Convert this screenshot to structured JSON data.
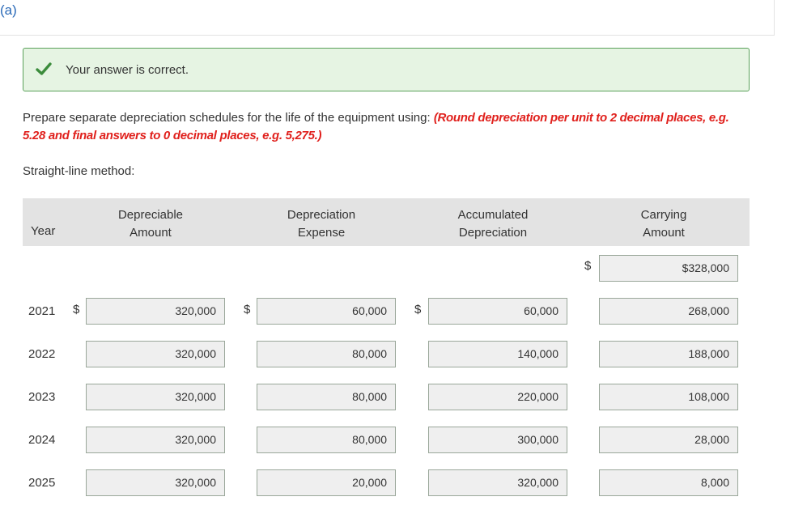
{
  "part": {
    "label": "(a)"
  },
  "feedback": {
    "message": "Your answer is correct."
  },
  "instructions": {
    "text": "Prepare separate depreciation schedules for the life of the equipment using: ",
    "note": "(Round depreciation per unit to 2 decimal places, e.g. 5.28 and final answers to 0 decimal places, e.g. 5,275.)"
  },
  "method": {
    "label": "Straight-line method:"
  },
  "table": {
    "headers": {
      "year": "Year",
      "depreciable_amount": [
        "Depreciable",
        "Amount"
      ],
      "depreciation_expense": [
        "Depreciation",
        "Expense"
      ],
      "accumulated_depreciation": [
        "Accumulated",
        "Depreciation"
      ],
      "carrying_amount": [
        "Carrying",
        "Amount"
      ]
    },
    "currency_symbol": "$",
    "initial_carrying_amount": "$328,000",
    "rows": [
      {
        "year": "2021",
        "depreciable_amount": "320,000",
        "depreciation_expense": "60,000",
        "accumulated_depreciation": "60,000",
        "carrying_amount": "268,000"
      },
      {
        "year": "2022",
        "depreciable_amount": "320,000",
        "depreciation_expense": "80,000",
        "accumulated_depreciation": "140,000",
        "carrying_amount": "188,000"
      },
      {
        "year": "2023",
        "depreciable_amount": "320,000",
        "depreciation_expense": "80,000",
        "accumulated_depreciation": "220,000",
        "carrying_amount": "108,000"
      },
      {
        "year": "2024",
        "depreciable_amount": "320,000",
        "depreciation_expense": "80,000",
        "accumulated_depreciation": "300,000",
        "carrying_amount": "28,000"
      },
      {
        "year": "2025",
        "depreciable_amount": "320,000",
        "depreciation_expense": "20,000",
        "accumulated_depreciation": "320,000",
        "carrying_amount": "8,000"
      }
    ]
  },
  "colors": {
    "correct_bg": "#e6f4e3",
    "correct_border": "#5aa15a",
    "check": "#3c8c3c",
    "note_red": "#e0201c",
    "link_blue": "#2a6ab8"
  }
}
